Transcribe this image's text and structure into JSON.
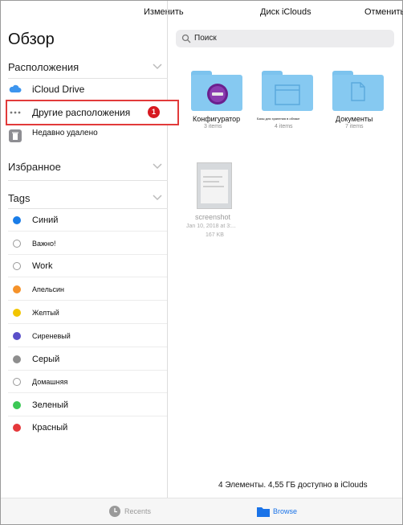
{
  "topbar": {
    "edit_label": "Изменить",
    "title": "Диск iClouds",
    "cancel_label": "Отменить"
  },
  "sidebar": {
    "title": "Обзор",
    "locations_header": "Расположения",
    "locations": [
      {
        "label": "iCloud Drive",
        "icon": "icloud-icon"
      },
      {
        "label": "Другие расположения",
        "icon": "more-icon",
        "badge": "1"
      },
      {
        "label": "Недавно удалено",
        "icon": "trash-icon"
      }
    ],
    "favorites_header": "Избранное",
    "tags_header": "Tags",
    "tags": [
      {
        "label": "Синий",
        "color": "#1a7de8"
      },
      {
        "label": "Важно!",
        "color": "hollow"
      },
      {
        "label": "Work",
        "color": "hollow"
      },
      {
        "label": "Апельсин",
        "color": "#f5922a"
      },
      {
        "label": "Желтый",
        "color": "#f2c500"
      },
      {
        "label": "Сиреневый",
        "color": "#5a4fc9"
      },
      {
        "label": "Серый",
        "color": "#8e8e8e"
      },
      {
        "label": "Домашняя",
        "color": "hollow"
      },
      {
        "label": "Зеленый",
        "color": "#3cc856"
      },
      {
        "label": "Красный",
        "color": "#e5383b"
      }
    ]
  },
  "search": {
    "placeholder": "Поиск"
  },
  "files": [
    {
      "name": "Конфигуратор",
      "meta": "3 items"
    },
    {
      "name": "Базы для хранения в облаке",
      "meta": "4 items"
    },
    {
      "name": "Документы",
      "meta": "7 items"
    }
  ],
  "screenshot_file": {
    "name": "screenshot",
    "date": "Jan 10, 2018 at 3:...",
    "size": "167 KB"
  },
  "storage_text": "4 Элементы. 4,55 ГБ доступно в iClouds",
  "bottombar": {
    "recents_label": "Recents",
    "browse_label": "Browse"
  }
}
